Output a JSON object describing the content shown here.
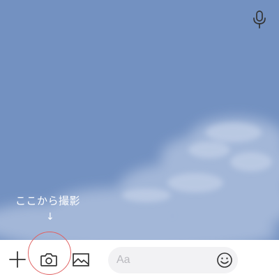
{
  "chat": {
    "background_color": "#7391c1",
    "hint_text": "ここから撮影",
    "hint_arrow": "↓",
    "highlight_color": "#e06060"
  },
  "toolbar": {
    "plus_icon": "plus-icon",
    "camera_icon": "camera-icon",
    "image_icon": "image-icon",
    "emoji_icon": "smiley-icon",
    "mic_icon": "microphone-icon",
    "icon_color": "#333333"
  },
  "message": {
    "placeholder": "Aa"
  }
}
